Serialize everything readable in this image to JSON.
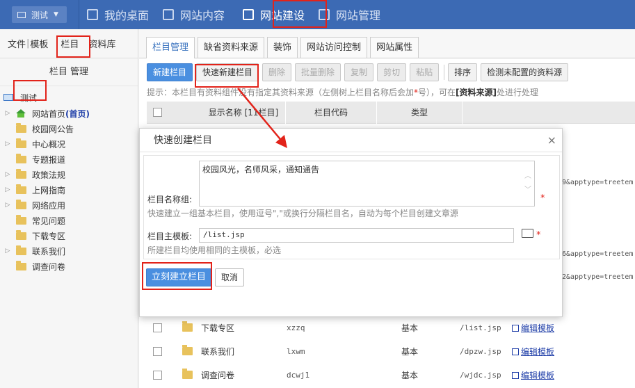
{
  "topbar": {
    "site_selector": "测试",
    "nav": [
      {
        "label": "我的桌面"
      },
      {
        "label": "网站内容"
      },
      {
        "label": "网站建设"
      },
      {
        "label": "网站管理"
      }
    ]
  },
  "left": {
    "tabs": [
      "文件",
      "模板",
      "栏目",
      "资料库"
    ],
    "title": "栏目 管理",
    "root": "测试",
    "tree": [
      {
        "label": "网站首页",
        "tag": "(首页)"
      },
      {
        "label": "校园网公告"
      },
      {
        "label": "中心概况"
      },
      {
        "label": "专题报道"
      },
      {
        "label": "政策法规"
      },
      {
        "label": "上网指南"
      },
      {
        "label": "网络应用"
      },
      {
        "label": "常见问题"
      },
      {
        "label": "下载专区"
      },
      {
        "label": "联系我们"
      },
      {
        "label": "调查问卷"
      }
    ]
  },
  "main": {
    "tabs": [
      "栏目管理",
      "缺省资料来源",
      "装饰",
      "网站访问控制",
      "网站属性"
    ],
    "toolbar": {
      "new": "新建栏目",
      "quick_new": "快速新建栏目",
      "delete": "删除",
      "batch_delete": "批量删除",
      "copy": "复制",
      "cut": "剪切",
      "paste": "粘贴",
      "sort": "排序",
      "check": "检测未配置的资料源"
    },
    "hint_a": "提示：本栏目有资料组件没有指定其资料来源（左侧树上栏目名称后会加",
    "hint_star": "*",
    "hint_b": "号），可在",
    "hint_bold": "[资料来源]",
    "hint_c": "处进行处理",
    "columns": {
      "name": "显示名称 [11栏目]",
      "code": "栏目代码",
      "type": "类型"
    },
    "url_fragments": [
      "9&apptype=treetem",
      "6&apptype=treetem",
      "2&apptype=treetem"
    ],
    "rows": [
      {
        "name": "下载专区",
        "code": "xzzq",
        "type": "基本",
        "template": "/list.jsp",
        "edit": "编辑模板"
      },
      {
        "name": "联系我们",
        "code": "lxwm",
        "type": "基本",
        "template": "/dpzw.jsp",
        "edit": "编辑模板"
      },
      {
        "name": "调查问卷",
        "code": "dcwj1",
        "type": "基本",
        "template": "/wjdc.jsp",
        "edit": "编辑模板"
      }
    ]
  },
  "dialog": {
    "title": "快速创建栏目",
    "close": "×",
    "name_label": "栏目名称组:",
    "name_value": "校园风光，名师风采，通知通告",
    "name_help": "快速建立一组基本栏目，使用逗号\",\"或换行分隔栏目名，自动为每个栏目创建文章源",
    "tpl_label": "栏目主模板:",
    "tpl_value": "/list.jsp",
    "tpl_help": "所建栏目均使用相同的主模板，必选",
    "required": "*",
    "create": "立刻建立栏目",
    "cancel": "取消"
  },
  "colors": {
    "brand": "#3c6ab4",
    "primary_button": "#4a8fe0",
    "highlight": "#e2231a"
  }
}
